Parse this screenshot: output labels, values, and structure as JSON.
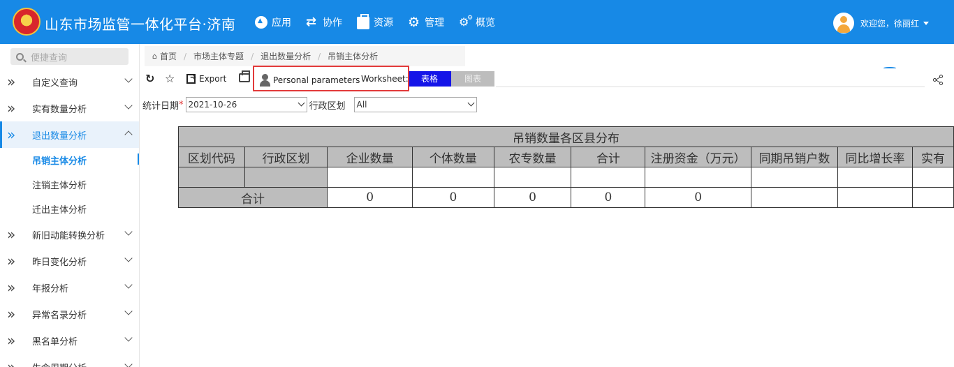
{
  "header": {
    "app_title": "山东市场监管一体化平台·济南",
    "nav": [
      {
        "icon": "app-icon",
        "label": "应用"
      },
      {
        "icon": "collaborate-icon",
        "label": "协作"
      },
      {
        "icon": "briefcase-icon",
        "label": "资源"
      },
      {
        "icon": "gear-icon",
        "label": "管理"
      },
      {
        "icon": "gears-icon",
        "label": "概览"
      }
    ],
    "user_greeting": "欢迎您，徐丽红"
  },
  "sidebar": {
    "search_placeholder": "便捷查询",
    "items": [
      {
        "label": "自定义查询",
        "expanded": false
      },
      {
        "label": "实有数量分析",
        "expanded": false
      },
      {
        "label": "退出数量分析",
        "expanded": true,
        "active": true,
        "children": [
          "吊销主体分析",
          "注销主体分析",
          "迁出主体分析"
        ],
        "current_child": "吊销主体分析"
      },
      {
        "label": "新旧动能转换分析",
        "expanded": false
      },
      {
        "label": "昨日变化分析",
        "expanded": false
      },
      {
        "label": "年报分析",
        "expanded": false
      },
      {
        "label": "异常名录分析",
        "expanded": false
      },
      {
        "label": "黑名单分析",
        "expanded": false
      },
      {
        "label": "生命周期分析",
        "expanded": false
      }
    ]
  },
  "breadcrumb": [
    "首页",
    "市场主体专题",
    "退出数量分析",
    "吊销主体分析"
  ],
  "toolbar": {
    "export_label": "Export",
    "params_label": "Personal parameters",
    "worksheet_label": "Worksheet:",
    "tabs": [
      "表格",
      "图表"
    ],
    "active_tab": "表格"
  },
  "filters": {
    "date_label": "统计日期",
    "date_value": "2021-10-26",
    "region_label": "行政区划",
    "region_value": "All"
  },
  "report": {
    "title": "吊销数量各区县分布",
    "columns": [
      "区划代码",
      "行政区划",
      "企业数量",
      "个体数量",
      "农专数量",
      "合计",
      "注册资金（万元）",
      "同期吊销户数",
      "同比增长率",
      "实有"
    ],
    "total_label": "合计",
    "totals": [
      "0",
      "0",
      "0",
      "0",
      "0",
      "",
      "",
      ""
    ]
  },
  "colors": {
    "header_bg": "#1789e6",
    "active_tab": "#1515e8",
    "highlight_border": "#e23a3a",
    "table_grey": "#bdbdbd"
  }
}
